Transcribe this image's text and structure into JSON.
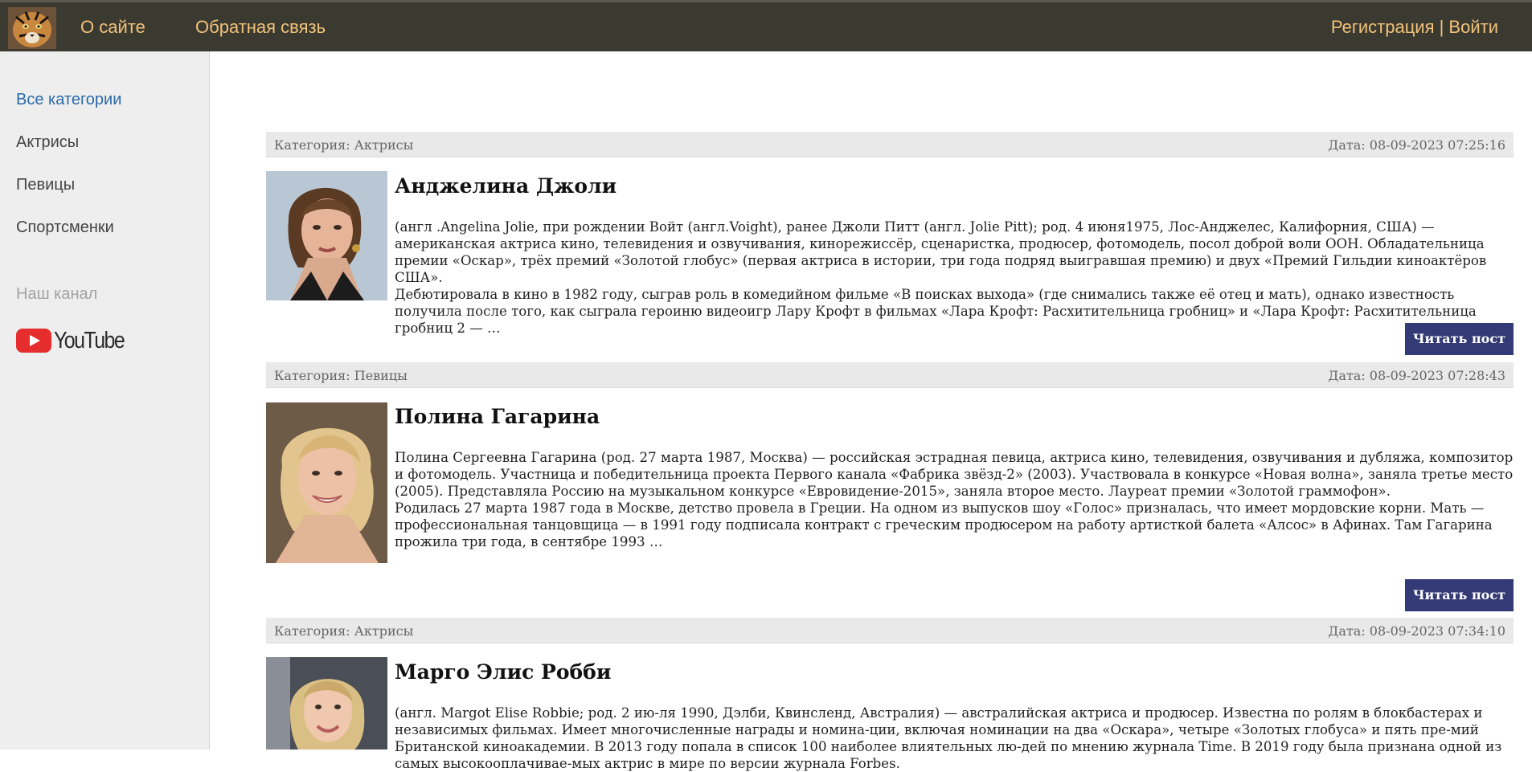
{
  "header": {
    "about_label": "О сайте",
    "feedback_label": "Обратная связь",
    "auth_label": "Регистрация | Войти"
  },
  "sidebar": {
    "items": [
      {
        "label": "Все категории",
        "active": true
      },
      {
        "label": "Актрисы",
        "active": false
      },
      {
        "label": "Певицы",
        "active": false
      },
      {
        "label": "Спортсменки",
        "active": false
      }
    ],
    "channel_heading": "Наш канал",
    "youtube_label": "YouTube"
  },
  "posts": [
    {
      "category": "Категория: Актрисы",
      "date": "Дата: 08-09-2023 07:25:16",
      "title": "Анджелина Джоли",
      "paragraph1": "(англ .Angelina Jolie, при рождении Войт (англ.Voight), ранее Джоли Питт (англ. Jolie Pitt); род. 4 июня1975, Лос-Анджелес, Калифорния, США) — американская актриса кино, телевидения и озвучивания, кинорежиссёр, сценаристка, продюсер, фотомодель, посол доброй воли ООН. Обладательница премии «Оскар», трёх премий «Золотой глобус» (первая актриса в истории, три года подряд выигравшая премию) и двух «Премий Гильдии киноактёров США».",
      "paragraph2": "Дебютировала в кино в 1982 году, сыграв роль в комедийном фильме «В поисках выхода» (где снимались также её отец и мать), однако известность получила после того, как сыграла героиню видеоигр Лару Крофт в фильмах «Лара Крофт: Расхитительница гробниц» и «Лара Крофт: Расхитительница гробниц 2 — …",
      "button_label": "Читать пост"
    },
    {
      "category": "Категория: Певицы",
      "date": "Дата: 08-09-2023 07:28:43",
      "title": "Полина Гагарина",
      "paragraph1": "Полина Сергеевна Гагарина (род. 27 марта 1987, Москва) — российская эстрадная певица, актриса кино, телевидения, озвучивания и дубляжа, композитор и фотомодель. Участница и победительница проекта Первого канала «Фабрика звёзд-2» (2003). Участвовала в конкурсе «Новая волна», заняла третье место (2005). Представляла Россию на музыкальном конкурсе «Евровидение-2015», заняла второе место. Лауреат премии «Золотой граммофон».",
      "paragraph2": "Родилась 27 марта 1987 года в Москве, детство провела в Греции. На одном из выпусков шоу «Голос» призналась, что имеет мордовские корни. Мать — профессиональная танцовщица — в 1991 году подписала контракт с греческим продюсером на работу артисткой балета «Алсос» в Афинах. Там Гагарина прожила три года, в сентябре 1993 …",
      "button_label": "Читать пост"
    },
    {
      "category": "Категория: Актрисы",
      "date": "Дата: 08-09-2023 07:34:10",
      "title": "Марго Элис Робби",
      "paragraph1": "(англ. Margot Elise Robbie; род. 2 ию-ля 1990, Дэлби, Квинсленд, Австралия) — австралийская актриса и продюсер. Известна по ролям в блокбастерах и независимых фильмах. Имеет многочисленные награды и номина-ции, включая номинации на два «Оскара», четыре «Золотых глобуса» и пять пре-мий Британской киноакадемии. В 2013 году попала в список 100 наиболее влиятельных лю-дей по мнению журнала Time. В 2019 году была признана одной из самых высокооплачивае-мых актрис в мире по версии журнала Forbes.",
      "paragraph2": ""
    }
  ]
}
